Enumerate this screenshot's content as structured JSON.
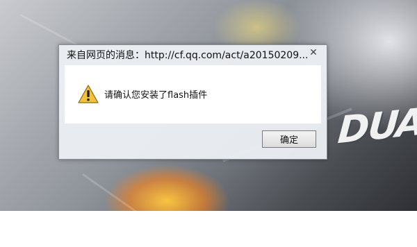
{
  "dialog": {
    "title": "来自网页的消息：http://cf.qq.com/act/a20150209...",
    "message": "请确认您安装了flash插件",
    "ok_label": "确定",
    "close_glyph": "✕"
  },
  "background": {
    "brand_text": "DUA"
  },
  "colors": {
    "dialog_bg": "#ebeef2",
    "content_bg": "#ffffff",
    "warning_yellow": "#f2c23a"
  }
}
